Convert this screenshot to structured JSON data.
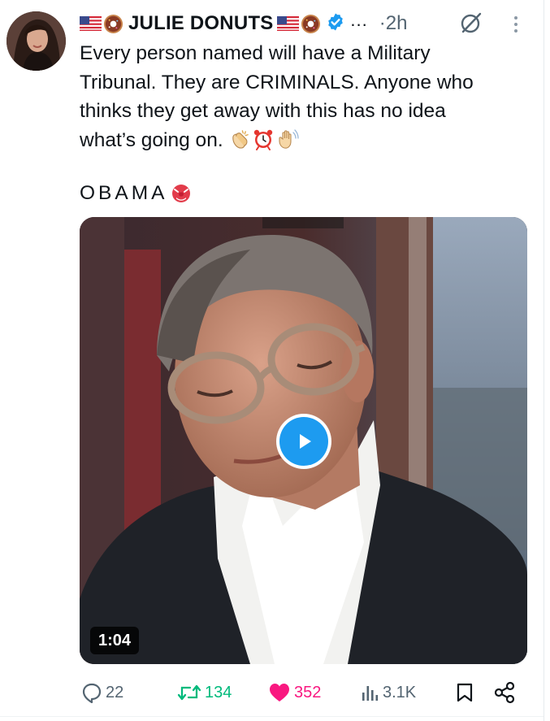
{
  "tweet": {
    "display_name": "JULIE DONUTS",
    "more_dots": "...",
    "timestamp": "·2h",
    "text_lines": [
      "Every person named will have a Military",
      "Tribunal. They are CRIMINALS. Anyone who",
      "thinks they get away with this has no idea",
      "what’s going on."
    ],
    "footer_text": "OBAMA",
    "emoji": [
      "clapping-hands",
      "alarm-clock",
      "waving-hand"
    ],
    "footer_emoji": "goblin-face"
  },
  "media": {
    "duration": "1:04",
    "play_label": "Play video"
  },
  "actions": {
    "replies": "22",
    "reposts": "134",
    "likes": "352",
    "views": "3.1K"
  },
  "colors": {
    "verified": "#1d9bf0",
    "repost": "#00ba7c",
    "like": "#f91880",
    "muted": "#536471",
    "text": "#0f1419"
  }
}
